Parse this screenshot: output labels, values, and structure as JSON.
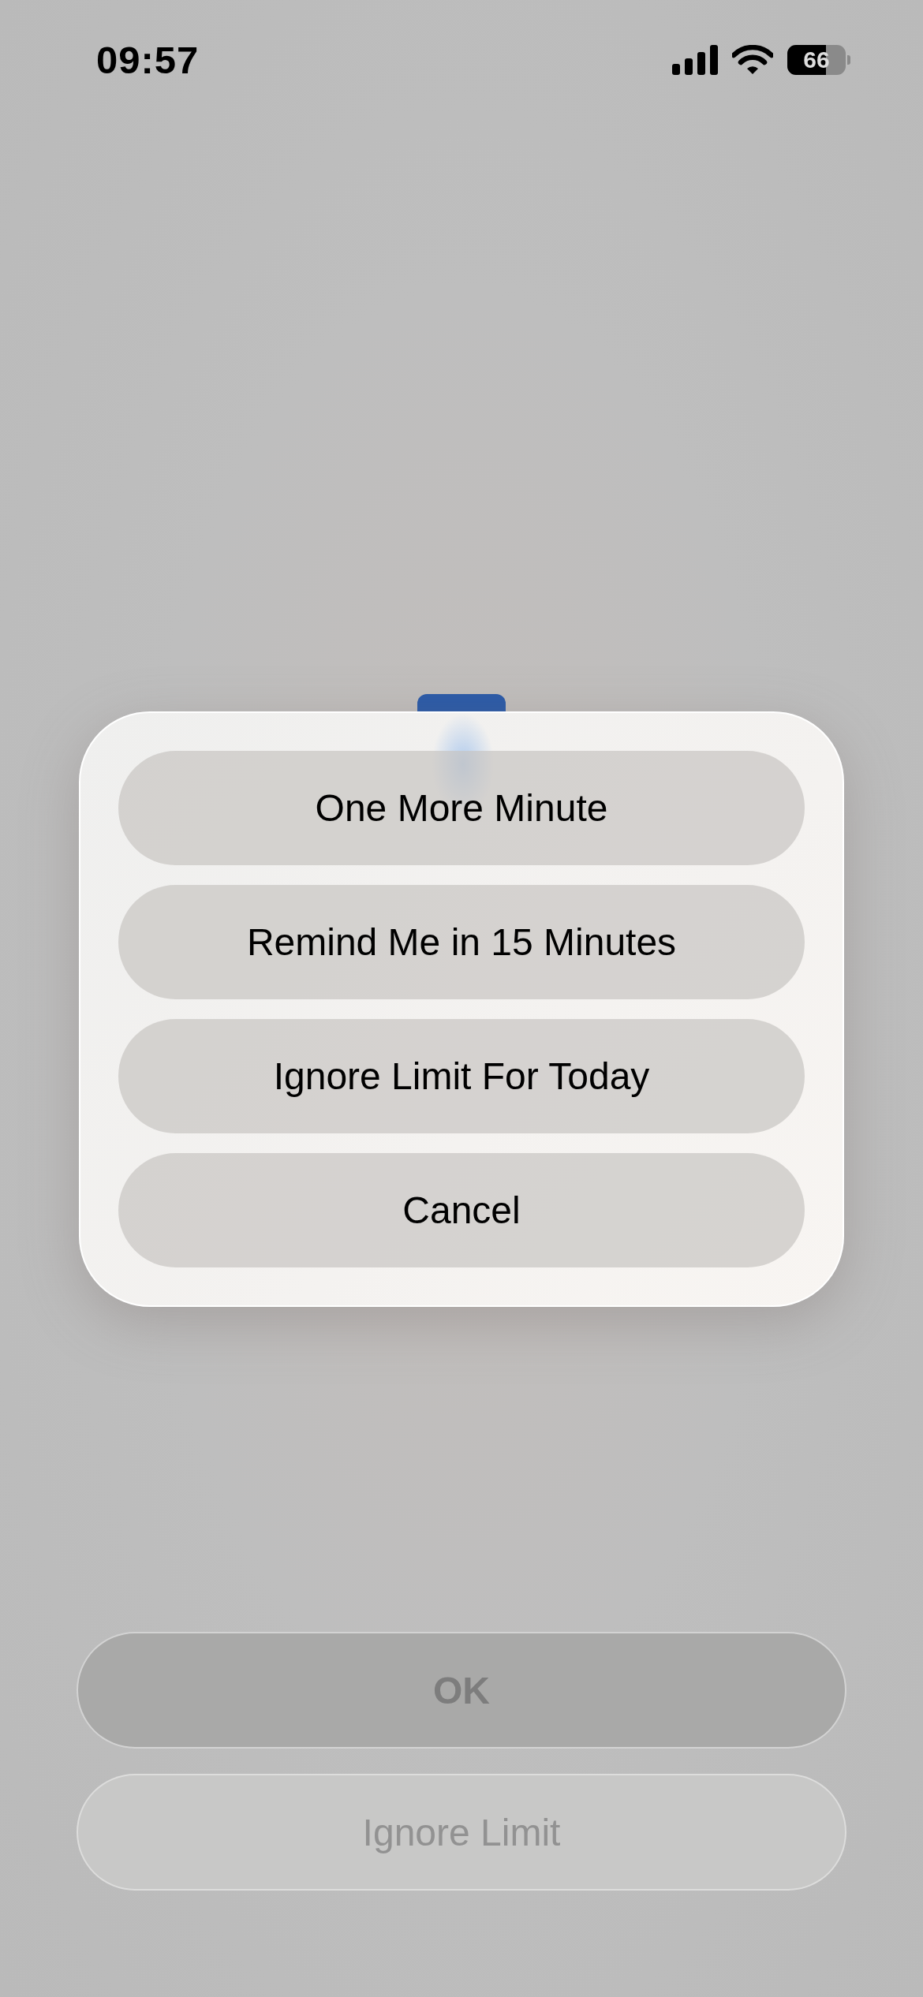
{
  "status_bar": {
    "time": "09:57",
    "battery": "66"
  },
  "action_sheet": {
    "options": [
      {
        "label": "One More Minute"
      },
      {
        "label": "Remind Me in 15 Minutes"
      },
      {
        "label": "Ignore Limit For Today"
      },
      {
        "label": "Cancel"
      }
    ]
  },
  "bottom_buttons": [
    {
      "label": "OK",
      "kind": "primary",
      "disabled": true
    },
    {
      "label": "Ignore Limit",
      "kind": "secondary",
      "disabled": true
    }
  ]
}
